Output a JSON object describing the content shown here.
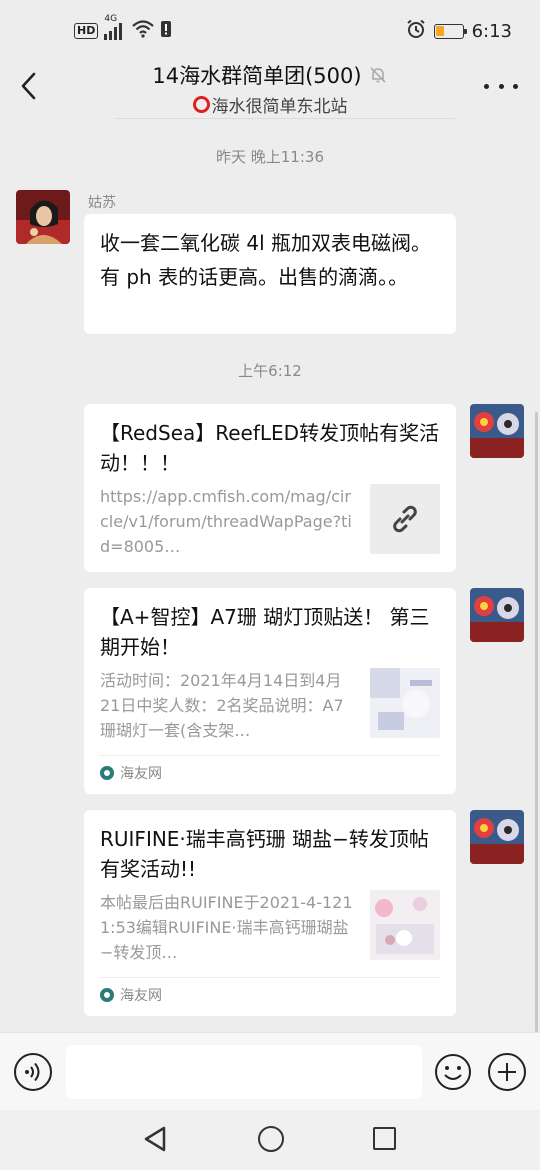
{
  "status_bar": {
    "hd": "HD",
    "network": "4G",
    "time": "6:13",
    "battery_level": 0.3,
    "battery_color": "#f5a623"
  },
  "header": {
    "title": "14海水群简单团(500)",
    "subtitle": "海水很简单东北站",
    "icons": [
      "back-arrow-icon",
      "mute-bell-icon",
      "more-icon",
      "red-ring-icon"
    ]
  },
  "messages": {
    "ts1": "昨天 晚上11:36",
    "msg1": {
      "sender": "姑苏",
      "text": "收一套二氧化碳 4l 瓶加双表电磁阀。有 ph 表的话更高。出售的滴滴。。"
    },
    "ts2": "上午6:12",
    "card1": {
      "title": "【RedSea】ReefLED转发顶帖有奖活动！！！",
      "desc": "https://app.cmfish.com/mag/circle/v1/forum/threadWapPage?tid=8005…",
      "thumb_icon": "link-icon"
    },
    "card2": {
      "title": "【A+智控】A7珊 瑚灯顶贴送！ 第三期开始！",
      "desc": "活动时间：2021年4月14日到4月21日中奖人数：2名奖品说明：A7珊瑚灯一套(含支架…",
      "source": "海友网"
    },
    "card3": {
      "title": "RUIFINE·瑞丰高钙珊 瑚盐−转发顶帖有奖活动!!",
      "desc": "本帖最后由RUIFINE于2021-4-1211:53编辑RUIFINE·瑞丰高钙珊瑚盐−转发顶…",
      "source": "海友网"
    }
  },
  "input_bar": {
    "icons": [
      "voice-icon",
      "emoji-icon",
      "plus-icon"
    ]
  },
  "colors": {
    "background": "#ededed",
    "bubble": "#ffffff",
    "accent_red": "#e02020"
  }
}
